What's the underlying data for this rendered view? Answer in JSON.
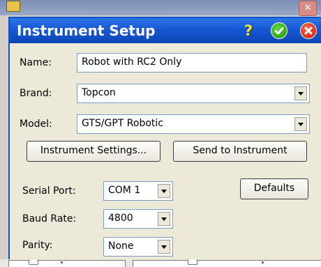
{
  "dialog": {
    "title": "Instrument Setup",
    "help_icon": "question-mark-icon",
    "ok_icon": "checkmark-icon",
    "cancel_icon": "close-icon"
  },
  "fields": {
    "name": {
      "label": "Name:",
      "value": "Robot with RC2 Only"
    },
    "brand": {
      "label": "Brand:",
      "value": "Topcon"
    },
    "model": {
      "label": "Model:",
      "value": "GTS/GPT Robotic"
    },
    "serial_port": {
      "label": "Serial Port:",
      "value": "COM 1"
    },
    "baud_rate": {
      "label": "Baud Rate:",
      "value": "4800"
    },
    "parity": {
      "label": "Parity:",
      "value": "None"
    }
  },
  "buttons": {
    "instrument_settings": "Instrument Settings...",
    "send_to_instrument": "Send to Instrument",
    "defaults": "Defaults"
  },
  "colors": {
    "title_bar": "#1658d4",
    "dialog_bg": "#ece9d8",
    "ok_green": "#1e8a12",
    "cancel_red": "#c4160a",
    "help_yellow": "#f4e24a"
  }
}
